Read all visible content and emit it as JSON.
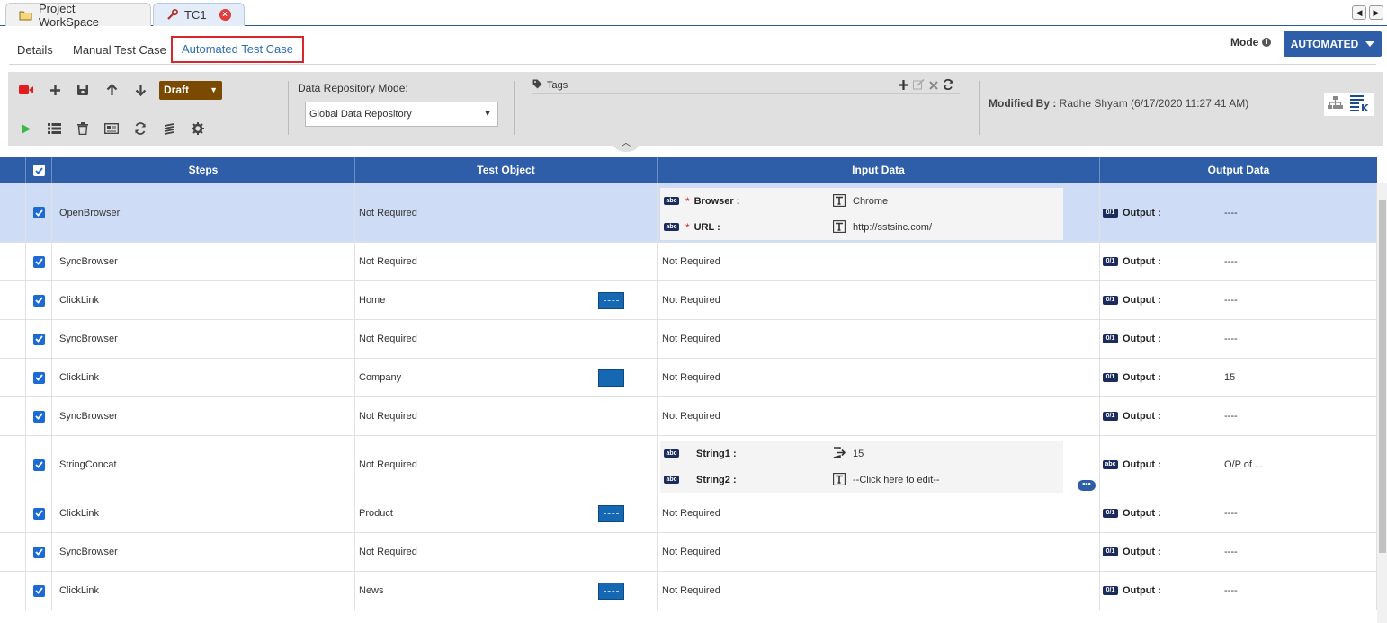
{
  "tabs": [
    {
      "label": "Project WorkSpace",
      "icon": "folder-icon"
    },
    {
      "label": "TC1",
      "icon": "wrench-icon",
      "closable": true
    }
  ],
  "subtabs": [
    "Details",
    "Manual Test Case",
    "Automated Test Case"
  ],
  "mode": {
    "label": "Mode",
    "value": "AUTOMATED"
  },
  "toolbar": {
    "status": "Draft",
    "data_repo_label": "Data Repository Mode:",
    "data_repo_value": "Global Data Repository",
    "tags_label": "Tags",
    "modified_label": "Modified By :",
    "modified_value": "Radhe Shyam (6/17/2020 11:27:41 AM)"
  },
  "grid": {
    "headers": [
      "Steps",
      "Test Object",
      "Input Data",
      "Output Data"
    ],
    "rows": [
      {
        "step": "OpenBrowser",
        "object": "Not Required",
        "has_obj_icon": false,
        "selected": true,
        "inputs": [
          {
            "name": "Browser :",
            "required": true,
            "value": "Chrome"
          },
          {
            "name": "URL :",
            "required": true,
            "value": "http://sstsinc.com/"
          }
        ],
        "output_label": "Output :",
        "output_value": "----",
        "out_icon": "0/1"
      },
      {
        "step": "SyncBrowser",
        "object": "Not Required",
        "input_text": "Not Required",
        "output_label": "Output :",
        "output_value": "----",
        "out_icon": "0/1"
      },
      {
        "step": "ClickLink",
        "object": "Home",
        "has_obj_icon": true,
        "input_text": "Not Required",
        "output_label": "Output :",
        "output_value": "----",
        "out_icon": "0/1"
      },
      {
        "step": "SyncBrowser",
        "object": "Not Required",
        "input_text": "Not Required",
        "output_label": "Output :",
        "output_value": "----",
        "out_icon": "0/1"
      },
      {
        "step": "ClickLink",
        "object": "Company",
        "has_obj_icon": true,
        "input_text": "Not Required",
        "output_label": "Output :",
        "output_value": "15",
        "out_icon": "0/1"
      },
      {
        "step": "SyncBrowser",
        "object": "Not Required",
        "input_text": "Not Required",
        "output_label": "Output :",
        "output_value": "----",
        "out_icon": "0/1"
      },
      {
        "step": "StringConcat",
        "object": "Not Required",
        "inputs": [
          {
            "name": "String1 :",
            "required": false,
            "value": "15"
          },
          {
            "name": "String2 :",
            "required": false,
            "value": "--Click here to edit--"
          }
        ],
        "output_label": "Output :",
        "output_value": "O/P of ...",
        "out_icon": "abc"
      },
      {
        "step": "ClickLink",
        "object": "Product",
        "has_obj_icon": true,
        "input_text": "Not Required",
        "output_label": "Output :",
        "output_value": "----",
        "out_icon": "0/1"
      },
      {
        "step": "SyncBrowser",
        "object": "Not Required",
        "input_text": "Not Required",
        "output_label": "Output :",
        "output_value": "----",
        "out_icon": "0/1"
      },
      {
        "step": "ClickLink",
        "object": "News",
        "has_obj_icon": true,
        "input_text": "Not Required",
        "output_label": "Output :",
        "output_value": "----",
        "out_icon": "0/1"
      }
    ]
  },
  "colors": {
    "accent": "#2e5ea7",
    "draft": "#7a4a00",
    "highlight": "#d9262c"
  }
}
